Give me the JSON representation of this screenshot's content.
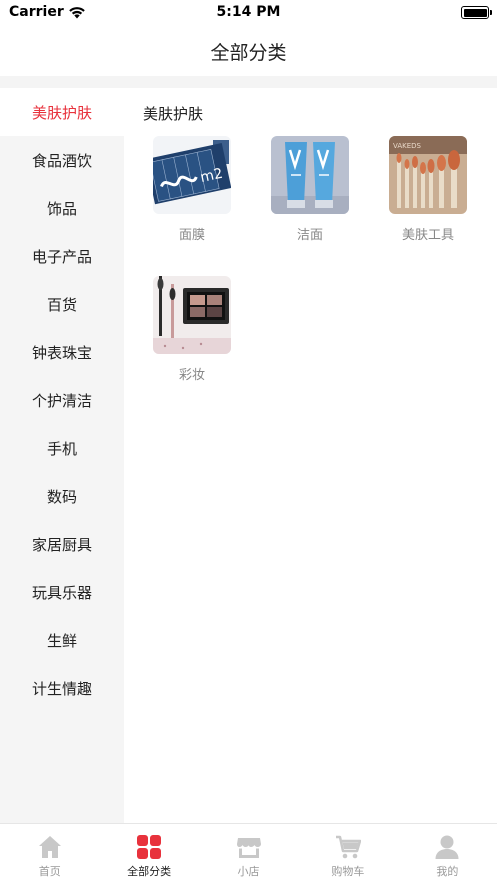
{
  "status_bar": {
    "carrier": "Carrier",
    "time": "5:14 PM"
  },
  "nav": {
    "title": "全部分类"
  },
  "sidebar": {
    "items": [
      {
        "label": "美肤护肤",
        "active": true
      },
      {
        "label": "食品酒饮"
      },
      {
        "label": "饰品"
      },
      {
        "label": "电子产品"
      },
      {
        "label": "百货"
      },
      {
        "label": "钟表珠宝"
      },
      {
        "label": "个护清洁"
      },
      {
        "label": "手机"
      },
      {
        "label": "数码"
      },
      {
        "label": "家居厨具"
      },
      {
        "label": "玩具乐器"
      },
      {
        "label": "生鲜"
      },
      {
        "label": "计生情趣"
      }
    ]
  },
  "content": {
    "section_title": "美肤护肤",
    "subcategories": [
      {
        "label": "面膜",
        "icon": "face-mask-image"
      },
      {
        "label": "洁面",
        "icon": "cleanser-image"
      },
      {
        "label": "美肤工具",
        "icon": "makeup-brushes-image"
      },
      {
        "label": "彩妆",
        "icon": "eyeshadow-palette-image"
      }
    ]
  },
  "tab_bar": {
    "tabs": [
      {
        "label": "首页",
        "icon": "home-icon"
      },
      {
        "label": "全部分类",
        "icon": "category-grid-icon",
        "active": true
      },
      {
        "label": "小店",
        "icon": "shop-icon"
      },
      {
        "label": "购物车",
        "icon": "cart-icon"
      },
      {
        "label": "我的",
        "icon": "profile-icon"
      }
    ]
  },
  "colors": {
    "accent": "#e8323c",
    "inactive_icon": "#c8c8c8",
    "sidebar_bg": "#f5f5f5"
  }
}
